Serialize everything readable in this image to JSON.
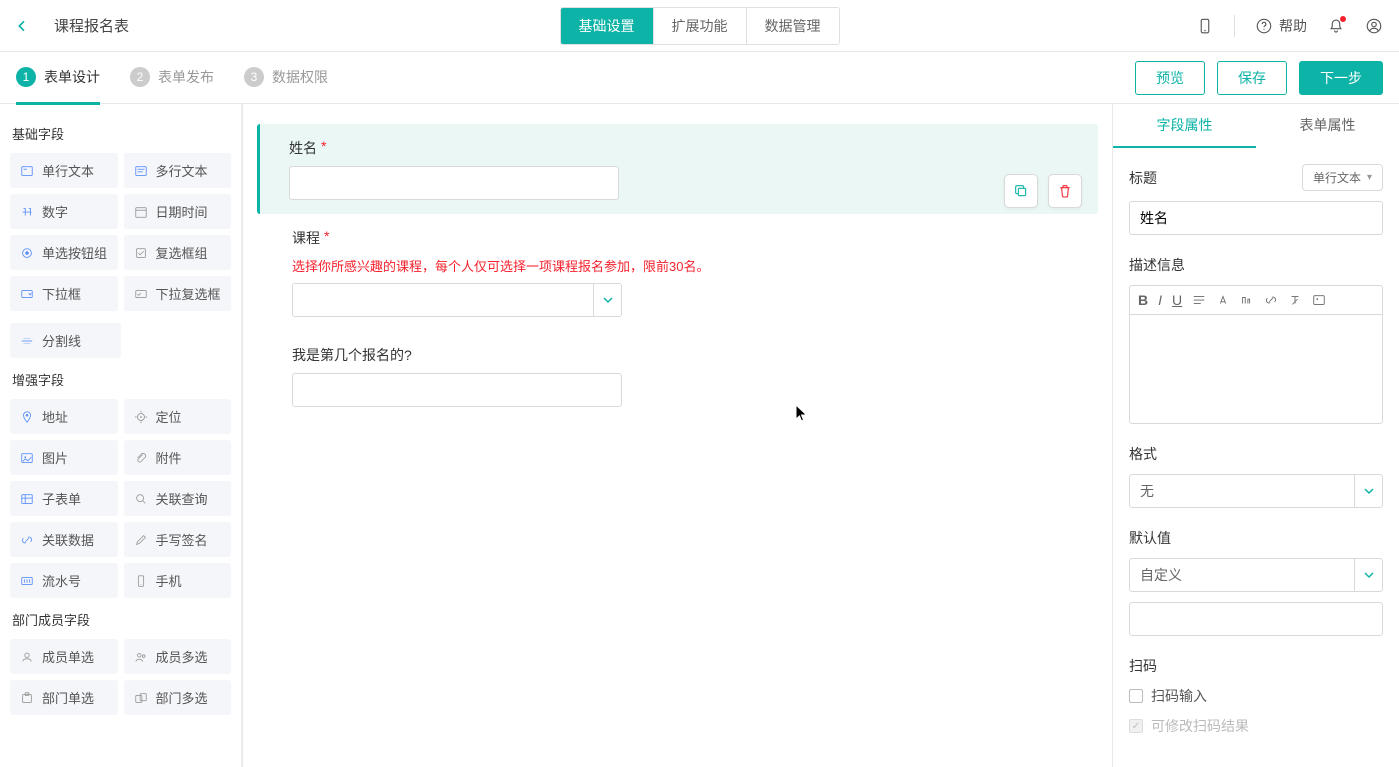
{
  "header": {
    "form_title": "课程报名表",
    "tabs": [
      "基础设置",
      "扩展功能",
      "数据管理"
    ],
    "help_label": "帮助"
  },
  "steps": {
    "items": [
      {
        "num": "1",
        "label": "表单设计"
      },
      {
        "num": "2",
        "label": "表单发布"
      },
      {
        "num": "3",
        "label": "数据权限"
      }
    ],
    "preview": "预览",
    "save": "保存",
    "next": "下一步"
  },
  "left": {
    "section_basic": "基础字段",
    "basic": [
      "单行文本",
      "多行文本",
      "数字",
      "日期时间",
      "单选按钮组",
      "复选框组",
      "下拉框",
      "下拉复选框",
      "分割线"
    ],
    "section_enhanced": "增强字段",
    "enhanced": [
      "地址",
      "定位",
      "图片",
      "附件",
      "子表单",
      "关联查询",
      "关联数据",
      "手写签名",
      "流水号",
      "手机"
    ],
    "section_dept": "部门成员字段",
    "dept": [
      "成员单选",
      "成员多选",
      "部门单选",
      "部门多选"
    ]
  },
  "form": {
    "f1": {
      "label": "姓名"
    },
    "f2": {
      "label": "课程",
      "hint": "选择你所感兴趣的课程，每个人仅可选择一项课程报名参加，限前30名。"
    },
    "f3": {
      "label": "我是第几个报名的?"
    }
  },
  "right": {
    "tab_field": "字段属性",
    "tab_form": "表单属性",
    "title_label": "标题",
    "type_badge": "单行文本",
    "title_value": "姓名",
    "desc_label": "描述信息",
    "format_label": "格式",
    "format_value": "无",
    "default_label": "默认值",
    "default_sel": "自定义",
    "scan_label": "扫码",
    "scan_opt1": "扫码输入",
    "scan_opt2": "可修改扫码结果"
  }
}
